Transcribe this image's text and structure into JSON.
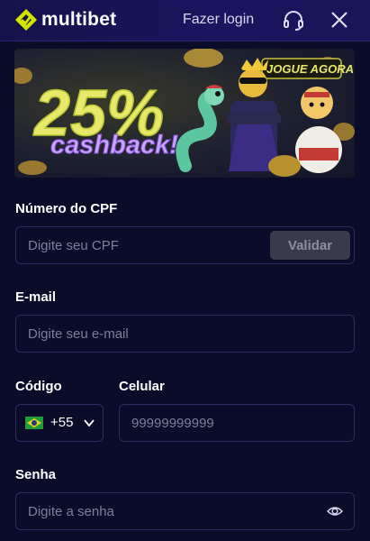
{
  "header": {
    "logo_text": "multibet",
    "login_label": "Fazer login"
  },
  "banner": {
    "headline": "25%",
    "subline": "cashback!",
    "cta_label": "JOGUE AGORA"
  },
  "form": {
    "cpf": {
      "label": "Número do CPF",
      "placeholder": "Digite seu CPF",
      "validate_label": "Validar"
    },
    "email": {
      "label": "E-mail",
      "placeholder": "Digite seu e-mail"
    },
    "code": {
      "label": "Código",
      "value": "+55"
    },
    "phone": {
      "label": "Celular",
      "placeholder": "99999999999"
    },
    "password": {
      "label": "Senha",
      "placeholder": "Digite a senha"
    }
  },
  "colors": {
    "accent": "#d4e600",
    "background": "#0b0b2a",
    "header": "#1b1560",
    "field_border": "#2e2e5e"
  },
  "icons": {
    "logo": "multibet-logo-icon",
    "support": "headset-icon",
    "close": "close-icon",
    "flag": "brazil-flag-icon",
    "dropdown": "chevron-down-icon",
    "password_toggle": "eye-icon"
  }
}
